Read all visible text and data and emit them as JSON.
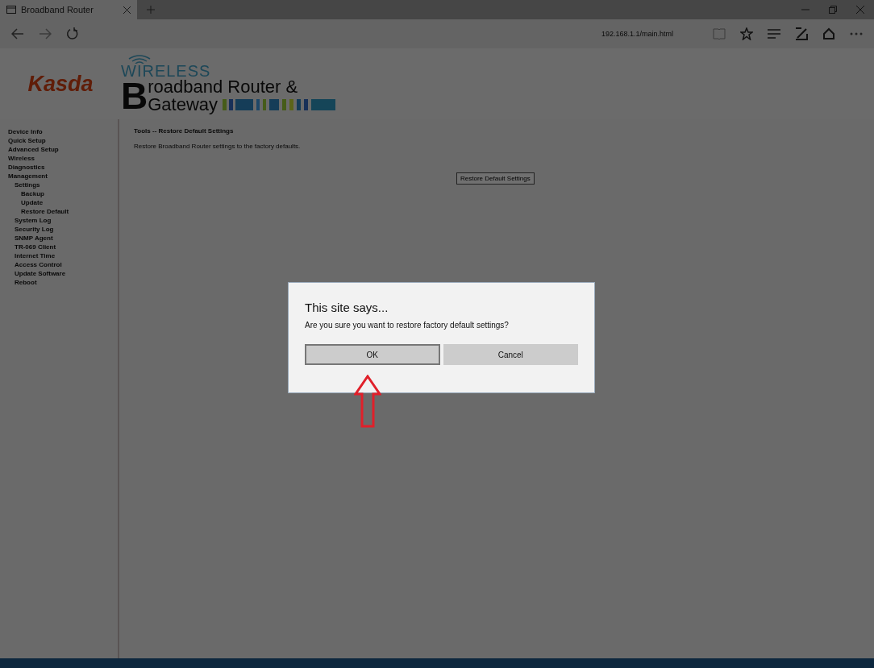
{
  "browser": {
    "tab_title": "Broadband Router",
    "address": "192.168.1.1/main.html"
  },
  "header": {
    "logo": "Kasda",
    "banner_top": "WIRELESS",
    "banner_letter": "B",
    "banner_line1": "roadband Router &",
    "banner_line2": "Gateway"
  },
  "sidebar": {
    "items": [
      {
        "label": "Device Info"
      },
      {
        "label": "Quick Setup"
      },
      {
        "label": "Advanced Setup"
      },
      {
        "label": "Wireless"
      },
      {
        "label": "Diagnostics"
      },
      {
        "label": "Management",
        "children": [
          {
            "label": "Settings",
            "children": [
              {
                "label": "Backup"
              },
              {
                "label": "Update"
              },
              {
                "label": "Restore Default"
              }
            ]
          },
          {
            "label": "System Log"
          },
          {
            "label": "Security Log"
          },
          {
            "label": "SNMP Agent"
          },
          {
            "label": "TR-069 Client"
          },
          {
            "label": "Internet Time"
          },
          {
            "label": "Access Control"
          },
          {
            "label": "Update Software"
          },
          {
            "label": "Reboot"
          }
        ]
      }
    ]
  },
  "content": {
    "title": "Tools -- Restore Default Settings",
    "description": "Restore Broadband Router settings to the factory defaults.",
    "button": "Restore Default Settings"
  },
  "dialog": {
    "title": "This site says...",
    "message": "Are you sure you want to restore factory default settings?",
    "buttons": [
      {
        "label": "OK",
        "selected": true
      },
      {
        "label": "Cancel",
        "selected": false
      }
    ]
  }
}
